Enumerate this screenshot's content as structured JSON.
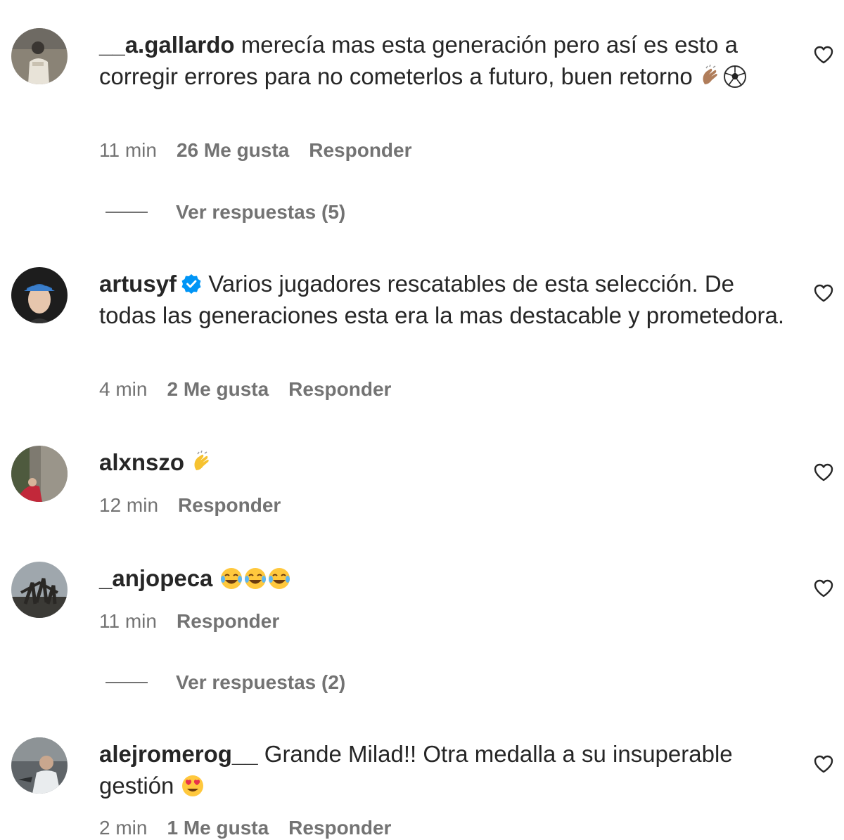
{
  "comments": [
    {
      "username": "__a.gallardo",
      "text": " merecía mas esta generación pero así es esto a corregir errores para no cometerlos a futuro, buen retorno ",
      "emoji": [
        "clapping-hands-emoji",
        "soccer-ball-emoji"
      ],
      "time": "11 min",
      "likes": "26 Me gusta",
      "reply_label": "Responder",
      "view_replies": "Ver respuestas (5)"
    },
    {
      "username": "artusyf",
      "verified": true,
      "text": " Varios jugadores rescatables de esta selección. De todas las generaciones esta era la mas destacable y prometedora.",
      "time": "4 min",
      "likes": "2 Me gusta",
      "reply_label": "Responder"
    },
    {
      "username": "alxnszo",
      "emoji": [
        "clapping-hands-emoji"
      ],
      "time": "12 min",
      "reply_label": "Responder"
    },
    {
      "username": "_anjopeca",
      "emoji": [
        "face-with-tears-of-joy-emoji",
        "face-with-tears-of-joy-emoji",
        "face-with-tears-of-joy-emoji"
      ],
      "time": "11 min",
      "reply_label": "Responder",
      "view_replies": "Ver respuestas (2)"
    },
    {
      "username": "alejromerog__",
      "text": " Grande Milad!! Otra medalla a su insuperable gestión ",
      "emoji": [
        "heart-eyes-emoji"
      ],
      "time": "2 min",
      "likes": "1 Me gusta",
      "reply_label": "Responder"
    }
  ],
  "colors": {
    "text": "#262626",
    "secondary": "#737373",
    "verified_blue": "#0095f6"
  }
}
